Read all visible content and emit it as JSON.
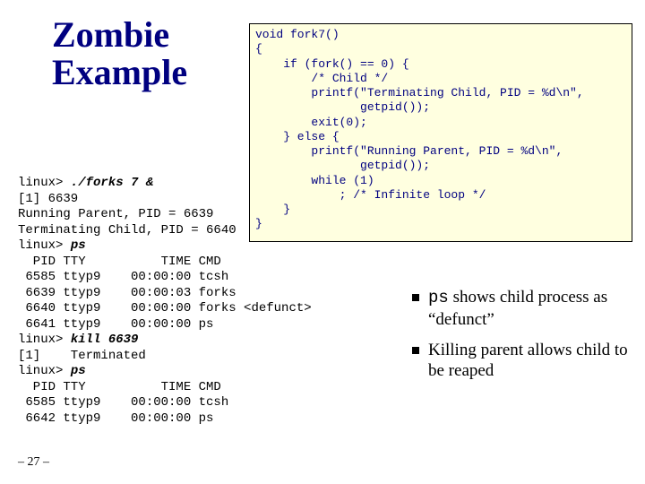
{
  "title_line1": "Zombie",
  "title_line2": "Example",
  "code": "void fork7()\n{\n    if (fork() == 0) {\n        /* Child */\n        printf(\"Terminating Child, PID = %d\\n\",\n               getpid());\n        exit(0);\n    } else {\n        printf(\"Running Parent, PID = %d\\n\",\n               getpid());\n        while (1)\n            ; /* Infinite loop */\n    }\n}",
  "terminal": {
    "l1a": "linux> ",
    "l1b": "./forks 7 &",
    "l2": "[1] 6639",
    "l3": "Running Parent, PID = 6639",
    "l4": "Terminating Child, PID = 6640",
    "l5a": "linux> ",
    "l5b": "ps",
    "l6": "  PID TTY          TIME CMD",
    "l7": " 6585 ttyp9    00:00:00 tcsh",
    "l8": " 6639 ttyp9    00:00:03 forks",
    "l9": " 6640 ttyp9    00:00:00 forks <defunct>",
    "l10": " 6641 ttyp9    00:00:00 ps",
    "l11a": "linux> ",
    "l11b": "kill 6639",
    "l12": "[1]    Terminated",
    "l13a": "linux> ",
    "l13b": "ps",
    "l14": "  PID TTY          TIME CMD",
    "l15": " 6585 ttyp9    00:00:00 tcsh",
    "l16": " 6642 ttyp9    00:00:00 ps"
  },
  "bullets": {
    "b1_mono": "ps",
    "b1_tail": " shows child process as “defunct”",
    "b2": "Killing parent allows child to be reaped"
  },
  "page_prefix": "– ",
  "page_num": "27",
  "page_suffix": " –"
}
